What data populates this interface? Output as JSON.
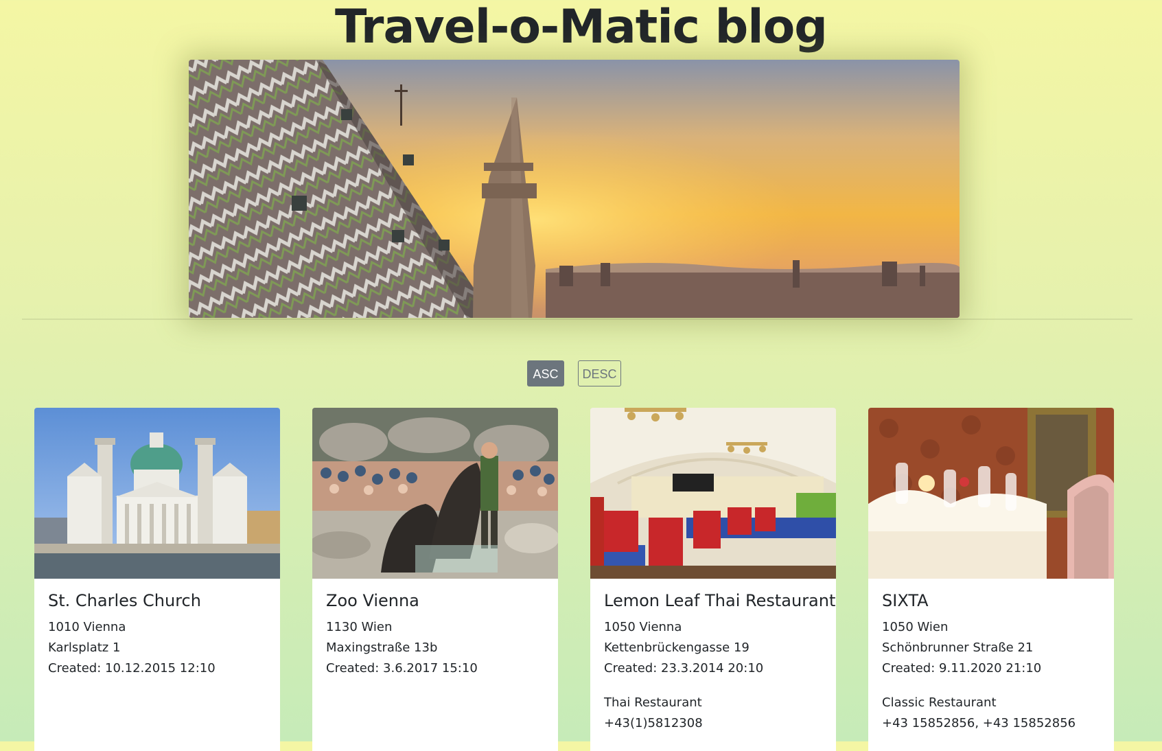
{
  "page": {
    "title": "Travel-o-Matic blog"
  },
  "hero": {
    "icon": "vienna-skyline-image"
  },
  "sort": {
    "asc_label": "ASC",
    "desc_label": "DESC"
  },
  "cards": [
    {
      "title": "St. Charles Church",
      "zip_city": "1010 Vienna",
      "address": "Karlsplatz 1",
      "created": "Created: 10.12.2015 12:10",
      "image": "st-charles-church-image"
    },
    {
      "title": "Zoo Vienna",
      "zip_city": "1130 Wien",
      "address": "Maxingstraße 13b",
      "created": "Created: 3.6.2017 15:10",
      "image": "zoo-vienna-image"
    },
    {
      "title": "Lemon Leaf Thai Restaurant",
      "zip_city": "1050 Vienna",
      "address": "Kettenbrückengasse 19",
      "created": "Created: 23.3.2014 20:10",
      "type": "Thai Restaurant",
      "phone": "+43(1)5812308",
      "image": "lemon-leaf-restaurant-image"
    },
    {
      "title": "SIXTA",
      "zip_city": "1050 Wien",
      "address": "Schönbrunner Straße 21",
      "created": "Created: 9.11.2020 21:10",
      "type": "Classic Restaurant",
      "phone": "+43 15852856, +43 15852856",
      "image": "sixta-restaurant-image"
    }
  ],
  "colors": {
    "bg_top": "#f4f6a4",
    "bg_bottom": "#c6ebb8",
    "button_gray": "#6c757d"
  }
}
